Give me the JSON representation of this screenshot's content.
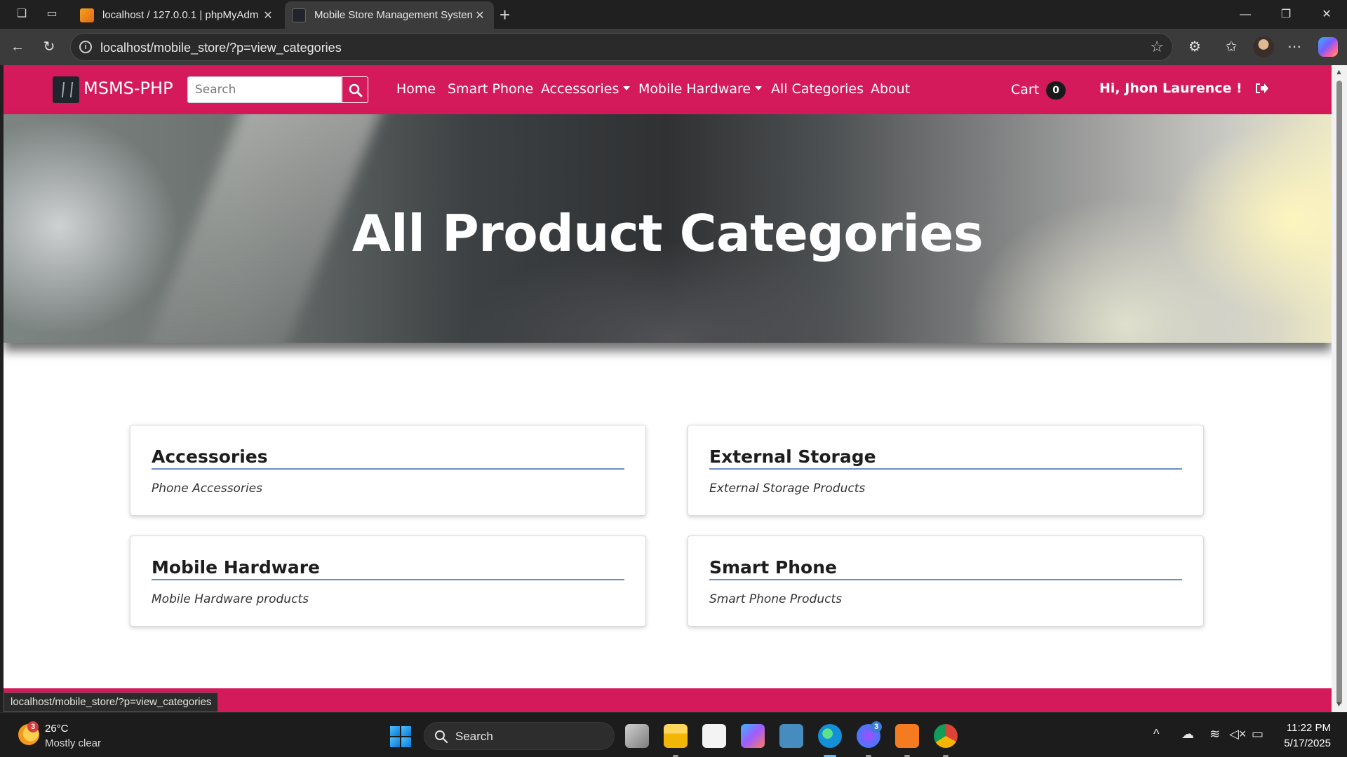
{
  "browser": {
    "tabs": [
      {
        "title": "localhost / 127.0.0.1 | phpMyAdm",
        "active": false
      },
      {
        "title": "Mobile Store Management Systen",
        "active": true
      }
    ],
    "url": "localhost/mobile_store/?p=view_categories",
    "status_url": "localhost/mobile_store/?p=view_categories"
  },
  "navbar": {
    "brand": "MSMS-PHP",
    "search_placeholder": "Search",
    "links": {
      "home": "Home",
      "smart_phone": "Smart Phone",
      "accessories": "Accessories",
      "mobile_hardware": "Mobile Hardware",
      "all_categories": "All Categories",
      "about": "About"
    },
    "cart_label": "Cart",
    "cart_count": "0",
    "greeting": "Hi, Jhon Laurence !"
  },
  "hero": {
    "title": "All Product Categories"
  },
  "categories": [
    {
      "name": "Accessories",
      "description": "Phone Accessories"
    },
    {
      "name": "External Storage",
      "description": "External Storage Products"
    },
    {
      "name": "Mobile Hardware",
      "description": "Mobile Hardware products"
    },
    {
      "name": "Smart Phone",
      "description": "Smart Phone Products"
    }
  ],
  "taskbar": {
    "weather_temp": "26°C",
    "weather_cond": "Mostly clear",
    "weather_badge": "3",
    "search_label": "Search",
    "messenger_badge": "3",
    "time": "11:22 PM",
    "date": "5/17/2025"
  },
  "colors": {
    "brand": "#d51a5b",
    "card_underline": "#6c8ec4"
  }
}
